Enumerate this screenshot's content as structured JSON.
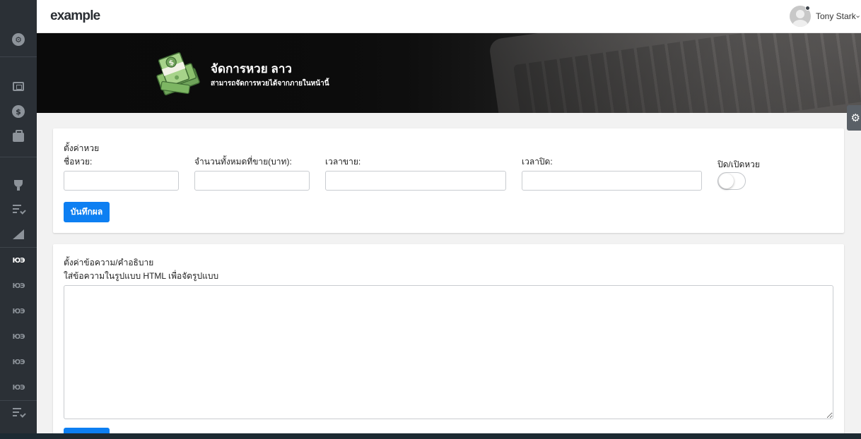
{
  "app": {
    "brand": "example"
  },
  "user": {
    "name": "Tony Stark",
    "caret": "⌄"
  },
  "banner": {
    "title": "จัดการหวย ลาว",
    "subtitle": "สามารถจัดการหวยได้จากภายในหน้านี้"
  },
  "sidebar": {
    "items": [
      {
        "icon": "settings-icon",
        "glyph": "⚙"
      },
      {
        "icon": "wallet-icon"
      },
      {
        "icon": "dollar-icon",
        "glyph": "$"
      },
      {
        "icon": "briefcase-icon"
      },
      {
        "icon": "trophy-icon"
      },
      {
        "icon": "checklist-icon"
      },
      {
        "icon": "triangle-ruler-icon"
      },
      {
        "icon": "lottery-icon",
        "text": "ЮЭ"
      },
      {
        "icon": "lottery-icon",
        "text": "ЮЭ"
      },
      {
        "icon": "lottery-icon",
        "text": "ЮЭ"
      },
      {
        "icon": "lottery-icon",
        "text": "ЮЭ"
      },
      {
        "icon": "lottery-icon",
        "text": "ЮЭ"
      },
      {
        "icon": "lottery-icon",
        "text": "ЮЭ"
      },
      {
        "icon": "checklist-icon"
      }
    ]
  },
  "settings_card": {
    "heading": "ตั้งค่าหวย",
    "fields": {
      "name_label": "ชื่อหวย:",
      "total_label": "จำนวนทั้งหมดที่ขาย(บาท):",
      "sell_time_label": "เวลาขาย:",
      "close_time_label": "เวลาปิด:",
      "toggle_label": "ปิด/เปิดหวย",
      "name_value": "",
      "total_value": "",
      "sell_time_value": "",
      "close_time_value": "",
      "toggle_on": false
    },
    "save_label": "บันทึกผล"
  },
  "text_card": {
    "heading": "ตั้งค่าข้อความ/คำอธิบาย",
    "hint": "ใส่ข้อความในรูปแบบ HTML เพื่อจัดรูปแบบ",
    "content": ""
  },
  "gear_tab": {
    "icon": "gear-icon",
    "glyph": "⚙"
  },
  "colors": {
    "primary": "#0d7ff2",
    "sidebar": "#2b3036",
    "banner_dark": "#0e0e0e"
  }
}
